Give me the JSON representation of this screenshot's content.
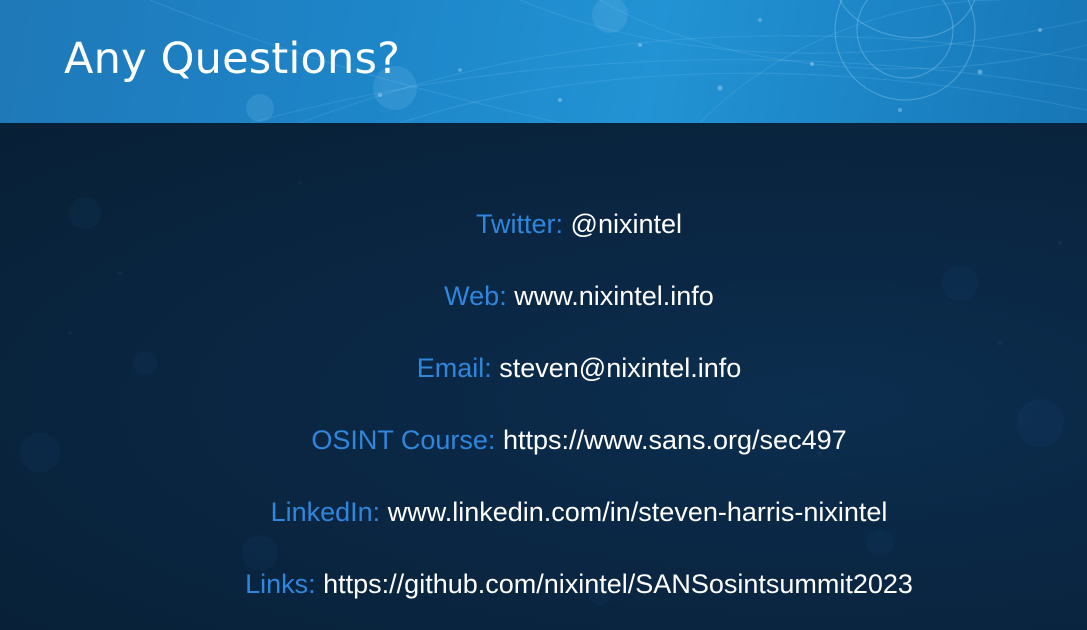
{
  "slide": {
    "title": "Any Questions?"
  },
  "contacts": [
    {
      "label": "Twitter:",
      "value": "@nixintel"
    },
    {
      "label": "Web:",
      "value": "www.nixintel.info"
    },
    {
      "label": "Email:",
      "value": "steven@nixintel.info"
    },
    {
      "label": "OSINT Course:",
      "value": "https://www.sans.org/sec497"
    },
    {
      "label": "LinkedIn:",
      "value": "www.linkedin.com/in/steven-harris-nixintel"
    },
    {
      "label": "Links:",
      "value": "https://github.com/nixintel/SANSosintsummit2023"
    }
  ],
  "colors": {
    "header_blue": "#1d86c9",
    "body_navy": "#0a2744",
    "label_blue": "#2f86dc",
    "value_white": "#ffffff"
  }
}
